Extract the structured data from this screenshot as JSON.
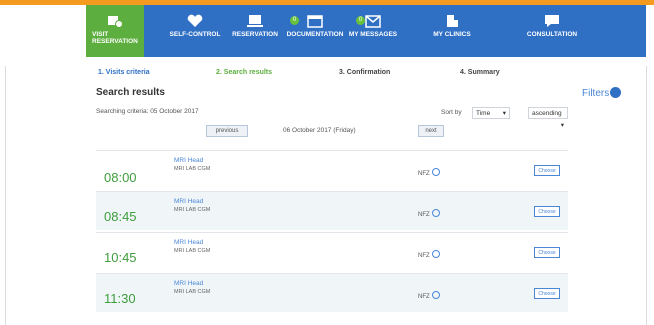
{
  "nav": {
    "items": [
      {
        "label": "VISIT RESERVATION",
        "icon": "calendar-plus-icon",
        "badge": ""
      },
      {
        "label": "SELF-CONTROL",
        "icon": "heart-monitor-icon",
        "badge": ""
      },
      {
        "label": "RESERVATION",
        "icon": "reservation-icon",
        "badge": ""
      },
      {
        "label": "DOCUMENTATION",
        "icon": "folder-icon",
        "badge": "0"
      },
      {
        "label": "MY MESSAGES",
        "icon": "envelope-icon",
        "badge": "0"
      },
      {
        "label": "MY CLINICS",
        "icon": "building-icon",
        "badge": ""
      },
      {
        "label": "CONSULTATION",
        "icon": "chat-icon",
        "badge": ""
      }
    ]
  },
  "steps": [
    "1. Visits criteria",
    "2. Search results",
    "3. Confirmation",
    "4. Summary"
  ],
  "page": {
    "title": "Search results",
    "filters_label": "Filters",
    "criteria": "Searching criteria: 05 October 2017",
    "sort_by_label": "Sort by",
    "sort_field": "Time",
    "sort_order": "ascending",
    "previous_label": "previous",
    "date_label": "06 October 2017 (Friday)",
    "next_label": "next"
  },
  "results": [
    {
      "time": "08:00",
      "service": "MRI Head",
      "lab": "MRI LAB CGM",
      "payer": "NFZ",
      "action": "Choose"
    },
    {
      "time": "08:45",
      "service": "MRI Head",
      "lab": "MRI LAB CGM",
      "payer": "NFZ",
      "action": "Choose"
    },
    {
      "time": "10:45",
      "service": "MRI Head",
      "lab": "MRI LAB CGM",
      "payer": "NFZ",
      "action": "Choose"
    },
    {
      "time": "11:30",
      "service": "MRI Head",
      "lab": "MRI LAB CGM",
      "payer": "NFZ",
      "action": "Choose"
    }
  ],
  "colors": {
    "nav_blue": "#2f6fc4",
    "active_green": "#5cae3e",
    "accent_orange": "#f39a1f",
    "time_green": "#3e9d3d"
  }
}
